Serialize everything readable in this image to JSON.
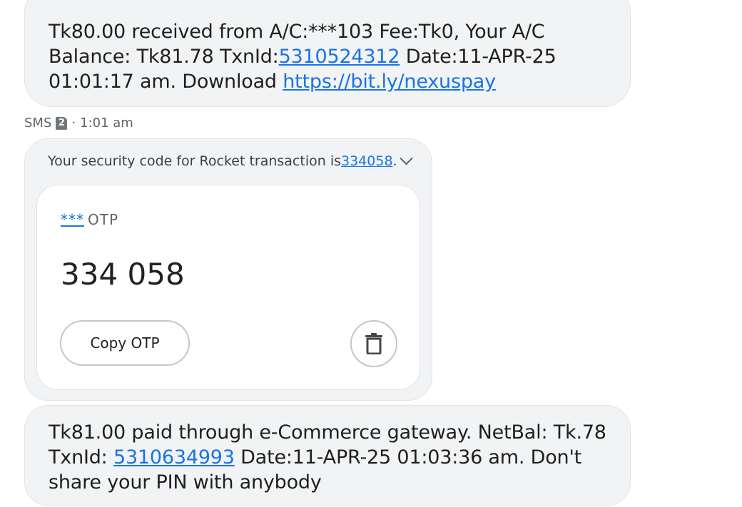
{
  "messages": [
    {
      "segments": [
        "Tk80.00 received from A/C:***103 Fee:Tk0, Your A/C Balance: Tk81.78 TxnId:",
        "5310524312",
        " Date:11-APR-25 01:01:17 am. Download ",
        "https://bit.ly/nexuspay"
      ]
    },
    {
      "meta": {
        "label": "SMS",
        "sim": "2",
        "separator": "·",
        "time": "1:01 am"
      },
      "preview_text": "Your security code for Rocket transaction is ",
      "preview_code": "334058",
      "preview_end": ".",
      "otp_card": {
        "sender_mask": "***",
        "sender_label": "OTP",
        "code": "334 058",
        "copy_label": "Copy OTP"
      }
    },
    {
      "segments": [
        "Tk81.00 paid through e-Commerce gateway. NetBal: Tk.78 TxnId: ",
        "5310634993",
        " Date:11-APR-25 01:03:36 am. Don't share your PIN with anybody"
      ]
    }
  ],
  "colors": {
    "bubble": "#f1f3f4",
    "link": "#1a73e8",
    "meta": "#5f6368"
  },
  "icons": {
    "delete": "trash-icon",
    "expand": "chevron-down-icon",
    "sim": "sim-card-icon"
  }
}
